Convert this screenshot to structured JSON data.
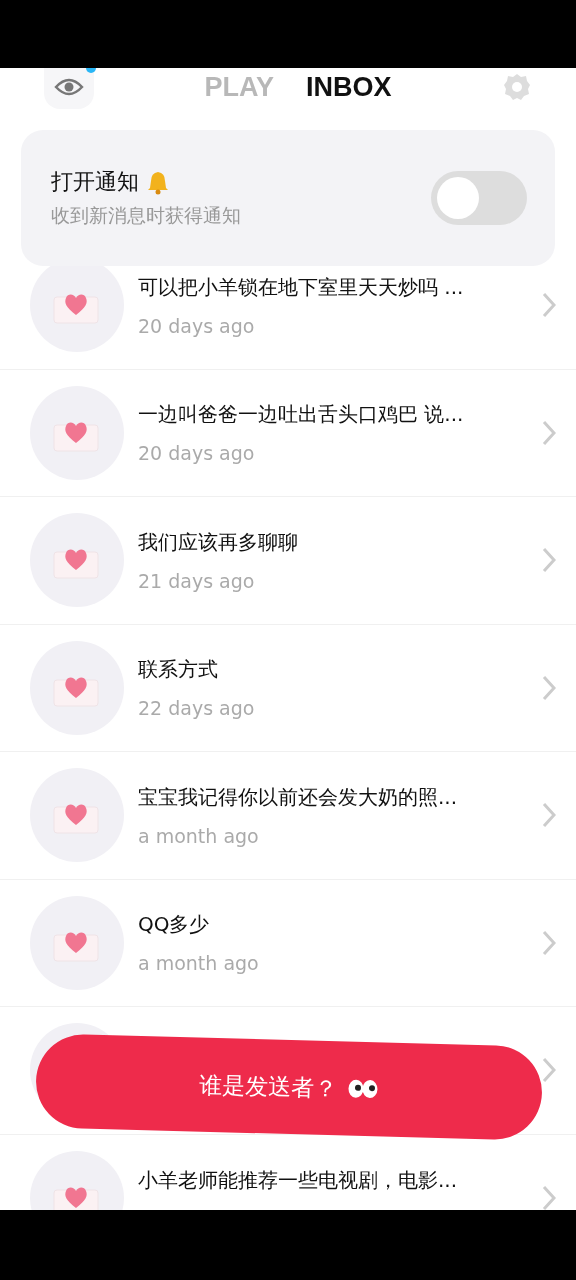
{
  "header": {
    "tabs": [
      {
        "label": "PLAY",
        "selected": false
      },
      {
        "label": "INBOX",
        "selected": true
      }
    ],
    "has_new": true
  },
  "notification_card": {
    "title": "打开通知",
    "subtitle": "收到新消息时获得通知",
    "on": false
  },
  "messages": [
    {
      "kind": "message",
      "text": "可以把小羊锁在地下室里天天炒吗 ...",
      "time": "20 days ago"
    },
    {
      "kind": "message",
      "text": "一边叫爸爸一边吐出舌头口鸡巴 说...",
      "time": "20 days ago"
    },
    {
      "kind": "message",
      "text": "我们应该再多聊聊",
      "time": "21 days ago"
    },
    {
      "kind": "message",
      "text": "联系方式",
      "time": "22 days ago"
    },
    {
      "kind": "message",
      "text": "宝宝我记得你以前还会发大奶的照...",
      "time": "a month ago"
    },
    {
      "kind": "message",
      "text": "QQ多少",
      "time": "a month ago"
    },
    {
      "kind": "covered"
    },
    {
      "kind": "message",
      "text": "小羊老师能推荐一些电视剧，电影..."
    }
  ],
  "action_button": {
    "label": "谁是发送者？"
  }
}
